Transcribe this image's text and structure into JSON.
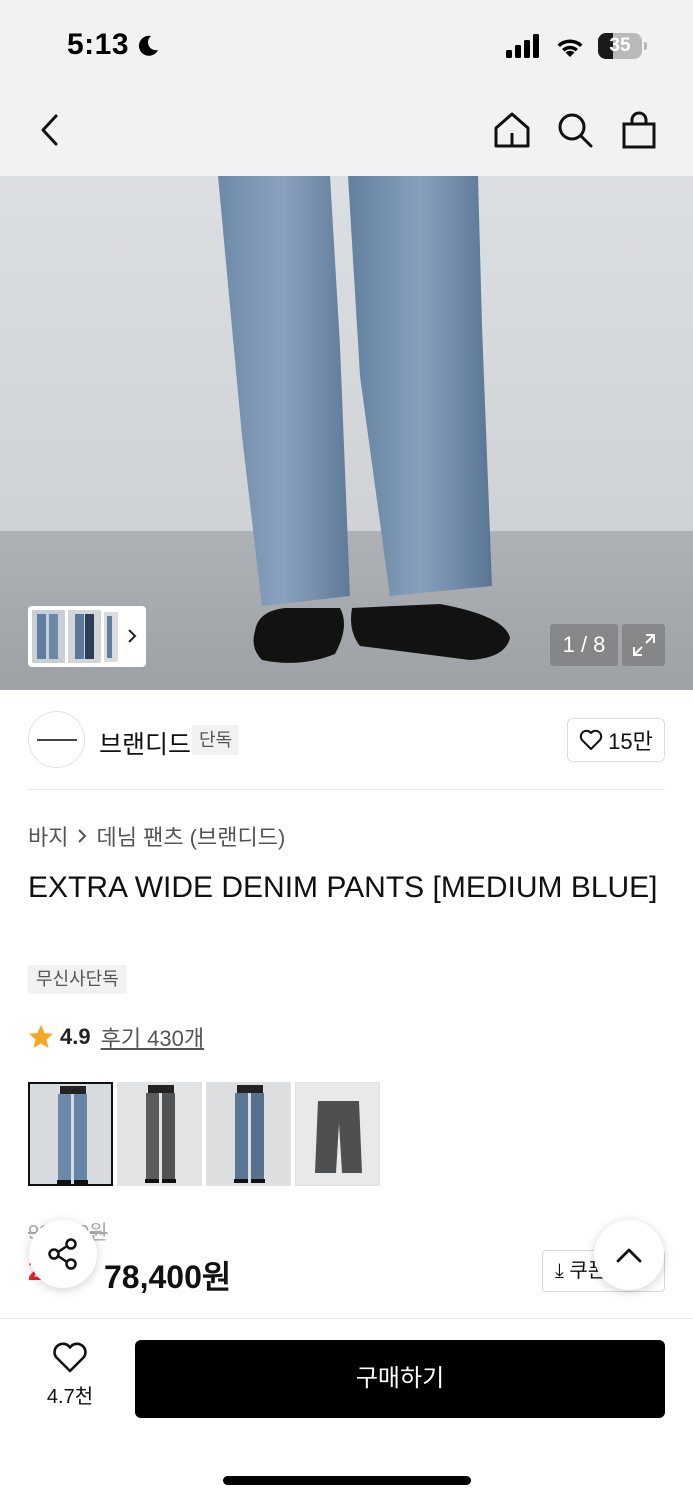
{
  "status_bar": {
    "time": "5:13",
    "battery": "35",
    "battery_level": 0.35
  },
  "header": {
    "icons": [
      "back-icon",
      "home-icon",
      "search-icon",
      "cart-icon"
    ]
  },
  "gallery": {
    "counter": "1 / 8"
  },
  "brand": {
    "name": "브랜디드",
    "tag": "단독",
    "likes": "15만"
  },
  "breadcrumb": {
    "category": "바지",
    "subcategory": "데님 팬츠 (브랜디드)"
  },
  "product": {
    "title": "EXTRA WIDE DENIM PANTS [MEDIUM BLUE]",
    "exclusive_tag": "무신사단독",
    "rating": "4.9",
    "reviews": "후기 430개"
  },
  "colors": [
    "medium-blue",
    "black",
    "washed-blue",
    "grey"
  ],
  "price": {
    "original": "98,000원",
    "discount": "20%",
    "sale": "78,400원",
    "coupon_label": "쿠폰"
  },
  "bottom": {
    "like_count": "4.7천",
    "buy_label": "구매하기"
  },
  "colors_hex": {
    "accent": "#ee1c25",
    "buy_bg": "#000000",
    "rating_star": "#f5a623"
  }
}
